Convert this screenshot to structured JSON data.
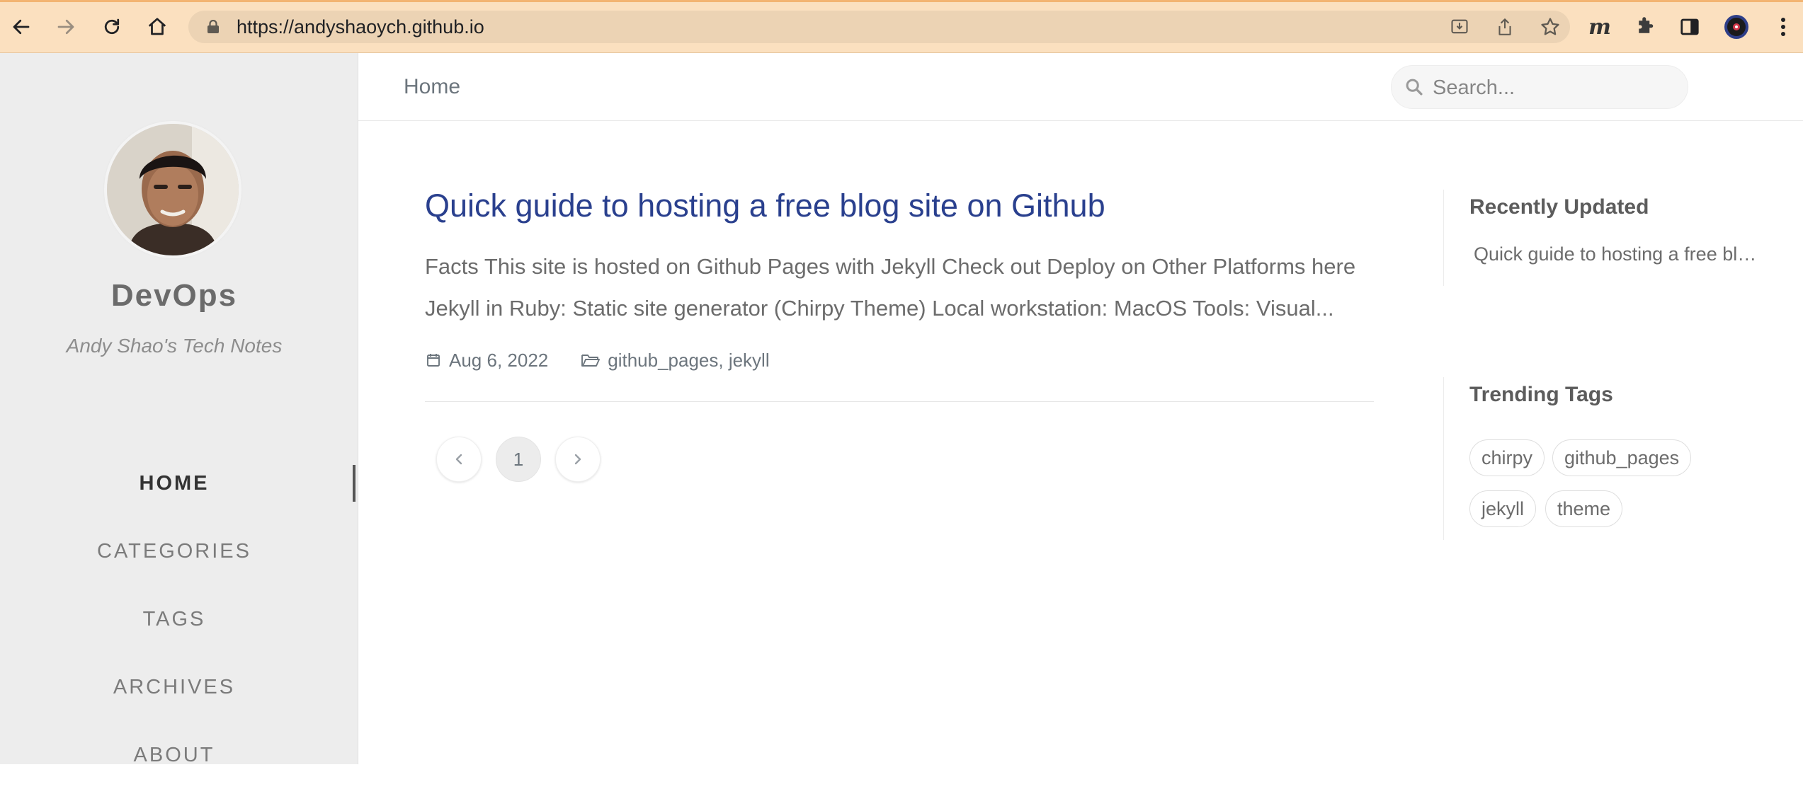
{
  "browser": {
    "url": "https://andyshaoych.github.io",
    "extension_letter": "m"
  },
  "sidebar": {
    "site_title": "DevOps",
    "site_subtitle": "Andy Shao's Tech Notes",
    "nav": [
      {
        "label": "HOME",
        "active": true
      },
      {
        "label": "CATEGORIES",
        "active": false
      },
      {
        "label": "TAGS",
        "active": false
      },
      {
        "label": "ARCHIVES",
        "active": false
      },
      {
        "label": "ABOUT",
        "active": false
      }
    ]
  },
  "topbar": {
    "breadcrumb": "Home",
    "search_placeholder": "Search..."
  },
  "post": {
    "title": "Quick guide to hosting a free blog site on Github",
    "excerpt_line1": "Facts This site is hosted on Github Pages with Jekyll Check out Deploy on Other Platforms here",
    "excerpt_line2": "Jekyll in Ruby: Static site generator (Chirpy Theme) Local workstation: MacOS Tools: Visual...",
    "date": "Aug 6, 2022",
    "categories": "github_pages, jekyll"
  },
  "pagination": {
    "current_page": "1"
  },
  "panel": {
    "recent_heading": "Recently Updated",
    "recent_items": [
      "Quick guide to hosting a free blog site on Github"
    ],
    "tags_heading": "Trending Tags",
    "tags": [
      "chirpy",
      "github_pages",
      "jekyll",
      "theme"
    ]
  },
  "colors": {
    "chrome_bg": "#fbe0bf",
    "sidebar_bg": "#ededed",
    "post_title": "#2a408e"
  }
}
